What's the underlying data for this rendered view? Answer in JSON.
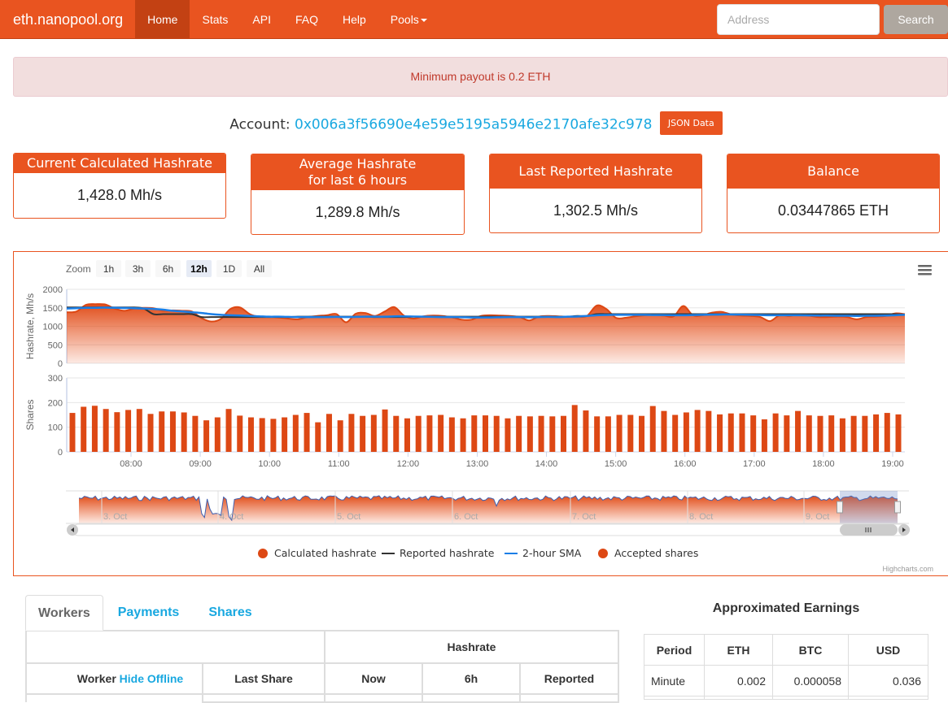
{
  "navbar": {
    "brand": "eth.nanopool.org",
    "items": [
      {
        "label": "Home",
        "active": true
      },
      {
        "label": "Stats",
        "active": false
      },
      {
        "label": "API",
        "active": false
      },
      {
        "label": "FAQ",
        "active": false
      },
      {
        "label": "Help",
        "active": false
      },
      {
        "label": "Pools",
        "active": false,
        "dropdown": true
      }
    ],
    "search_placeholder": "Address",
    "search_value": "",
    "search_button": "Search"
  },
  "alert": {
    "text": "Minimum payout is 0.2 ETH"
  },
  "account": {
    "label": "Account:",
    "address": "0x006a3f56690e4e59e5195a5946e2170afe32c978",
    "json_button": "JSON Data"
  },
  "stats": [
    {
      "title": "Current Calculated Hashrate",
      "value": "1,428.0 Mh/s"
    },
    {
      "title": "Average Hashrate",
      "title2": "for last 6 hours",
      "value": "1,289.8 Mh/s"
    },
    {
      "title": "Last Reported Hashrate",
      "value": "1,302.5 Mh/s"
    },
    {
      "title": "Balance",
      "value": "0.03447865 ETH"
    }
  ],
  "colors": {
    "accent": "#e95420",
    "link": "#19a8e0",
    "sma": "#1a7ee6",
    "reported": "#333333",
    "bar": "#dd4814"
  },
  "chart_data": [
    {
      "type": "area",
      "title": "Hashrate",
      "ylabel": "Hashrate, Mh/s",
      "ylim": [
        0,
        2000
      ],
      "yticks": [
        "0",
        "500",
        "1000",
        "1500",
        "2000"
      ],
      "xticks": [
        "08:00",
        "09:00",
        "10:00",
        "11:00",
        "12:00",
        "13:00",
        "14:00",
        "15:00",
        "16:00",
        "17:00",
        "18:00",
        "19:00"
      ],
      "x_start": "07:20",
      "x_step_minutes": 10,
      "series": [
        {
          "name": "Calculated hashrate",
          "kind": "area",
          "values": [
            1380,
            1400,
            1580,
            1600,
            1590,
            1480,
            1420,
            1480,
            1500,
            1490,
            1420,
            1430,
            1420,
            1400,
            1220,
            1130,
            1200,
            1470,
            1510,
            1330,
            1260,
            1260,
            1240,
            1210,
            1190,
            1250,
            1280,
            1300,
            1330,
            1110,
            1340,
            1360,
            1280,
            1400,
            1520,
            1290,
            1210,
            1270,
            1290,
            1280,
            1240,
            1180,
            1180,
            1280,
            1300,
            1290,
            1280,
            1250,
            1160,
            1260,
            1280,
            1270,
            1260,
            1260,
            1280,
            1560,
            1470,
            1230,
            1230,
            1270,
            1300,
            1310,
            1290,
            1270,
            1550,
            1300,
            1300,
            1370,
            1390,
            1320,
            1290,
            1280,
            1250,
            1140,
            1300,
            1280,
            1330,
            1290,
            1250,
            1250,
            1260,
            1250,
            1190,
            1250,
            1260,
            1280,
            1350,
            1330
          ]
        },
        {
          "name": "Reported hashrate",
          "kind": "line",
          "values": [
            1510,
            1510,
            1510,
            1510,
            1510,
            1510,
            1510,
            1510,
            1480,
            1330,
            1330,
            1330,
            1330,
            1330,
            1250,
            1250,
            1250,
            1250,
            1250,
            1250,
            1250,
            1250,
            1250,
            1250,
            1260,
            1260,
            1260,
            1260,
            1260,
            1260,
            1260,
            1260,
            1250,
            1250,
            1250,
            1250,
            1260,
            1260,
            1260,
            1260,
            1260,
            1260,
            1260,
            1260,
            1260,
            1260,
            1260,
            1260,
            1260,
            1260,
            1260,
            1260,
            1260,
            1280,
            1280,
            1330,
            1330,
            1330,
            1330,
            1330,
            1330,
            1330,
            1330,
            1330,
            1330,
            1330,
            1330,
            1330,
            1330,
            1330,
            1330,
            1330,
            1330,
            1330,
            1330,
            1330,
            1330,
            1330,
            1330,
            1330,
            1330,
            1330,
            1330,
            1330,
            1330,
            1330,
            1330,
            1320
          ]
        },
        {
          "name": "2-hour SMA",
          "kind": "line",
          "values": [
            1480,
            1490,
            1500,
            1500,
            1505,
            1500,
            1495,
            1490,
            1480,
            1470,
            1450,
            1420,
            1400,
            1380,
            1360,
            1330,
            1310,
            1300,
            1290,
            1280,
            1270,
            1260,
            1260,
            1255,
            1250,
            1250,
            1250,
            1250,
            1255,
            1250,
            1255,
            1260,
            1260,
            1260,
            1270,
            1270,
            1265,
            1260,
            1255,
            1250,
            1250,
            1245,
            1240,
            1240,
            1240,
            1245,
            1250,
            1250,
            1245,
            1250,
            1255,
            1250,
            1260,
            1265,
            1280,
            1300,
            1305,
            1310,
            1310,
            1310,
            1310,
            1305,
            1305,
            1300,
            1300,
            1305,
            1310,
            1315,
            1320,
            1320,
            1315,
            1310,
            1305,
            1300,
            1300,
            1300,
            1300,
            1295,
            1290,
            1290,
            1285,
            1285,
            1280,
            1285,
            1285,
            1290,
            1300,
            1310
          ]
        }
      ]
    },
    {
      "type": "bar",
      "title": "Accepted shares",
      "ylabel": "Shares",
      "ylim": [
        0,
        300
      ],
      "yticks": [
        "0",
        "100",
        "200",
        "300"
      ],
      "series": [
        {
          "name": "Accepted shares",
          "values": [
            158,
            183,
            187,
            174,
            161,
            170,
            174,
            154,
            164,
            164,
            160,
            146,
            128,
            140,
            174,
            147,
            140,
            137,
            134,
            140,
            150,
            158,
            120,
            154,
            128,
            154,
            146,
            150,
            172,
            146,
            136,
            146,
            148,
            150,
            140,
            136,
            148,
            148,
            146,
            136,
            146,
            144,
            146,
            144,
            146,
            190,
            168,
            144,
            144,
            150,
            150,
            146,
            186,
            166,
            150,
            160,
            170,
            166,
            152,
            156,
            156,
            148,
            132,
            156,
            148,
            166,
            148,
            146,
            148,
            136,
            146,
            146,
            152,
            158,
            152
          ]
        }
      ]
    }
  ],
  "chart_ui": {
    "zoom_label": "Zoom",
    "zoom_buttons": [
      "1h",
      "3h",
      "6h",
      "12h",
      "1D",
      "All"
    ],
    "zoom_selected": "12h",
    "navigator_labels": [
      "3. Oct",
      "4. Oct",
      "5. Oct",
      "6. Oct",
      "7. Oct",
      "8. Oct",
      "9. Oct"
    ],
    "legend": [
      {
        "label": "Calculated hashrate",
        "symbol": "circle"
      },
      {
        "label": "Reported hashrate",
        "symbol": "line-dark"
      },
      {
        "label": "2-hour SMA",
        "symbol": "line-blue"
      },
      {
        "label": "Accepted shares",
        "symbol": "circle"
      }
    ],
    "credits": "Highcharts.com",
    "menu_icon": "hamburger-menu-icon"
  },
  "tabs": [
    {
      "label": "Workers",
      "active": true
    },
    {
      "label": "Payments",
      "active": false
    },
    {
      "label": "Shares",
      "active": false
    }
  ],
  "workers_table": {
    "group_header": "Hashrate",
    "columns": [
      "Worker",
      "Last Share",
      "Now",
      "6h",
      "Reported"
    ],
    "hide_offline": "Hide Offline"
  },
  "earnings": {
    "title": "Approximated Earnings",
    "columns": [
      "Period",
      "ETH",
      "BTC",
      "USD"
    ],
    "rows": [
      {
        "period": "Minute",
        "eth": "0.002",
        "btc": "0.000058",
        "usd": "0.036"
      }
    ]
  }
}
